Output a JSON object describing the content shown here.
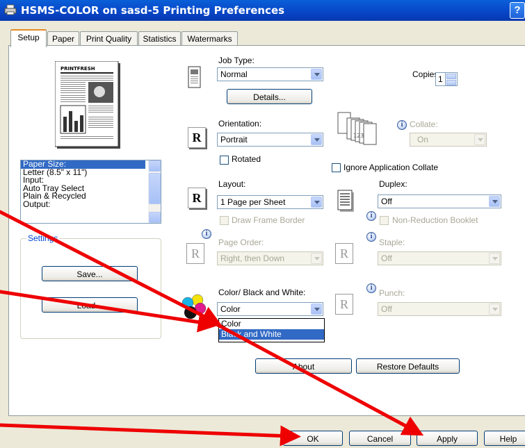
{
  "window": {
    "title": "HSMS-COLOR on sasd-5 Printing Preferences",
    "help_glyph": "?"
  },
  "tabs": [
    {
      "label": "Setup",
      "active": true
    },
    {
      "label": "Paper"
    },
    {
      "label": "Print Quality"
    },
    {
      "label": "Statistics"
    },
    {
      "label": "Watermarks"
    }
  ],
  "preview": {
    "masthead": "PRINTFRESH"
  },
  "summary_list": [
    "Paper Size:",
    "Letter (8.5\" x 11\")",
    "Input:",
    "Auto Tray Select",
    "Plain & Recycled",
    "Output:"
  ],
  "settings": {
    "group_label": "Settings",
    "save": "Save...",
    "load": "Load..."
  },
  "job_type": {
    "label": "Job Type:",
    "value": "Normal",
    "details_button": "Details..."
  },
  "copies": {
    "label": "Copies:",
    "value": "1"
  },
  "orientation": {
    "label": "Orientation:",
    "value": "Portrait",
    "rotated_label": "Rotated"
  },
  "collate": {
    "label": "Collate:",
    "value": "On",
    "stack_digits": "123"
  },
  "ignore_collate": {
    "label": "Ignore Application Collate"
  },
  "layout": {
    "label": "Layout:",
    "value": "1 Page per Sheet",
    "draw_frame_label": "Draw Frame Border"
  },
  "duplex": {
    "label": "Duplex:",
    "value": "Off",
    "booklet_label": "Non-Reduction Booklet"
  },
  "page_order": {
    "label": "Page Order:",
    "value": "Right, then Down"
  },
  "staple": {
    "label": "Staple:",
    "value": "Off"
  },
  "color_mode": {
    "label": "Color/ Black and White:",
    "value": "Color",
    "options": [
      "Color",
      "Black and White"
    ]
  },
  "punch": {
    "label": "Punch:",
    "value": "Off"
  },
  "buttons": {
    "about": "About",
    "restore_defaults": "Restore Defaults",
    "ok": "OK",
    "cancel": "Cancel",
    "apply": "Apply",
    "help": "Help"
  },
  "icon_letter": "R",
  "info_glyph": "i",
  "colors": {
    "titlebar": "#0847c8",
    "selection": "#316ac5",
    "arrow": "#ee0000",
    "active_tab_accent": "#e68b2c"
  }
}
